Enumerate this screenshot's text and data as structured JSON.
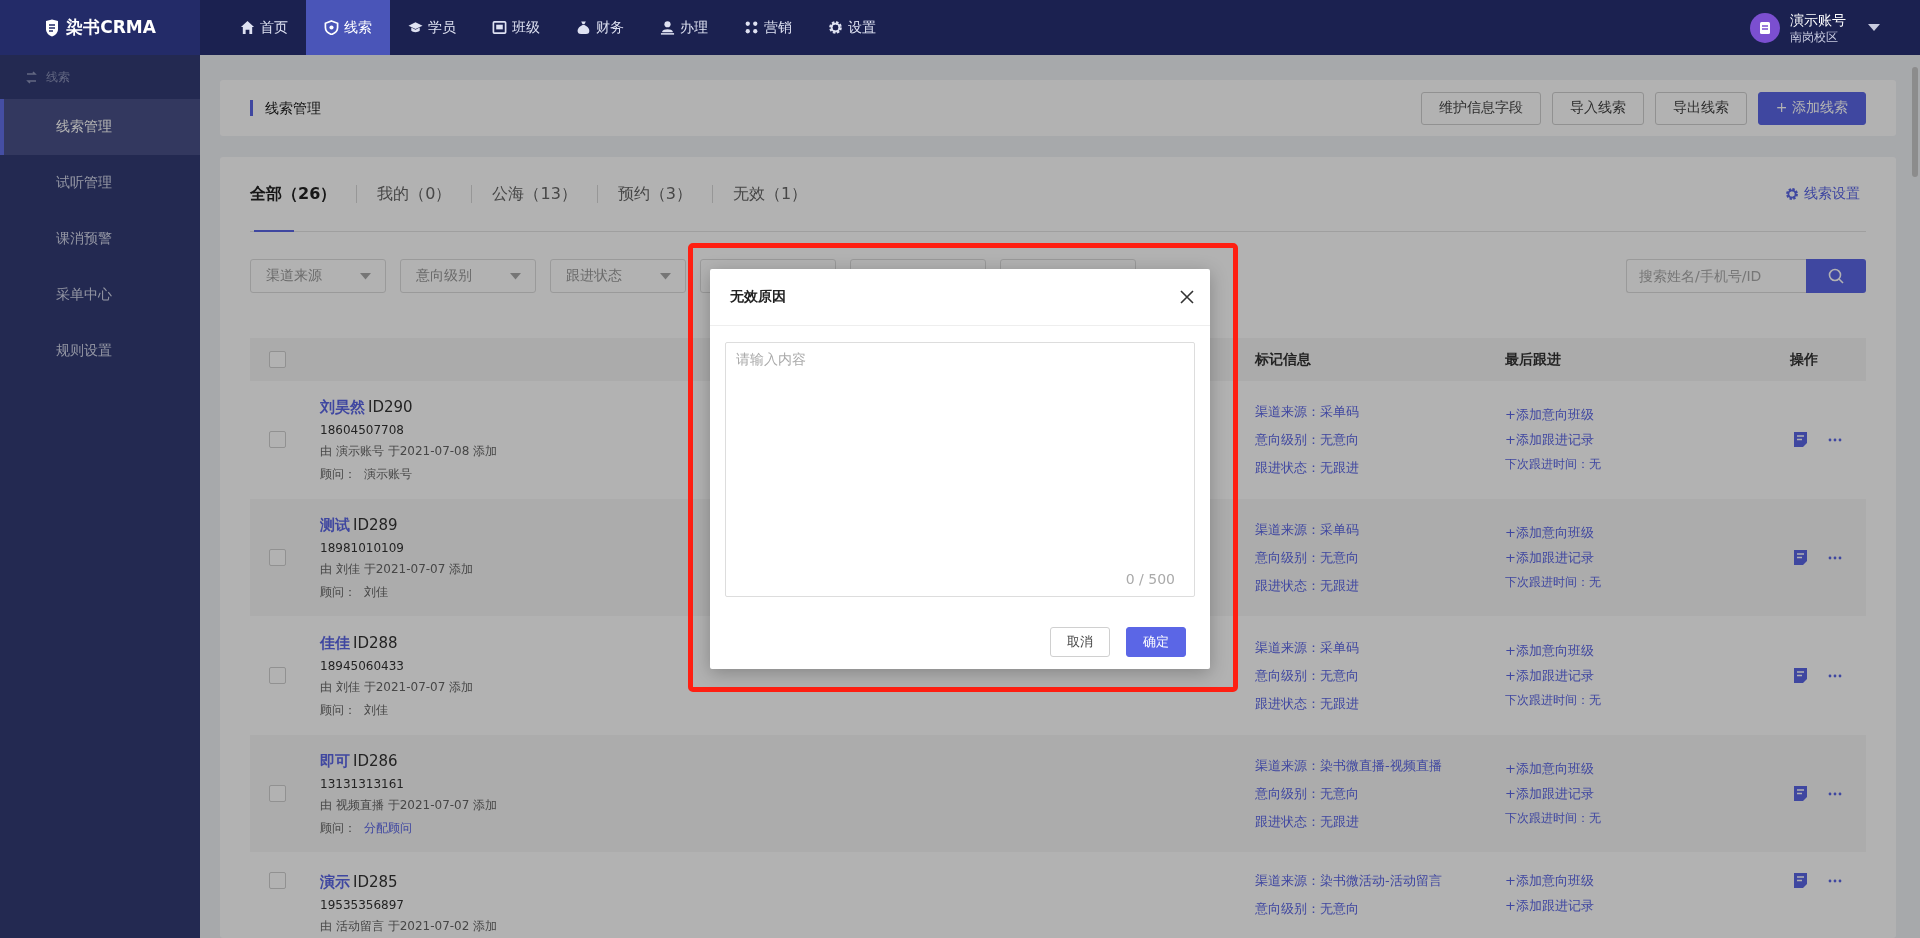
{
  "top_nav": {
    "logo": "染书CRMA",
    "items": [
      {
        "label": "首页",
        "selected": false
      },
      {
        "label": "线索",
        "selected": true
      },
      {
        "label": "学员",
        "selected": false
      },
      {
        "label": "班级",
        "selected": false
      },
      {
        "label": "财务",
        "selected": false
      },
      {
        "label": "办理",
        "selected": false
      },
      {
        "label": "营销",
        "selected": false
      },
      {
        "label": "设置",
        "selected": false
      }
    ],
    "user": {
      "name": "演示账号",
      "campus": "南岗校区"
    }
  },
  "sidebar": {
    "section": "线索",
    "items": [
      {
        "label": "线索管理",
        "selected": true
      },
      {
        "label": "试听管理",
        "selected": false
      },
      {
        "label": "课消预警",
        "selected": false
      },
      {
        "label": "采单中心",
        "selected": false
      },
      {
        "label": "规则设置",
        "selected": false
      }
    ]
  },
  "page_header": {
    "title": "线索管理",
    "buttons": [
      {
        "label": "维护信息字段",
        "kind": "default"
      },
      {
        "label": "导入线索",
        "kind": "default"
      },
      {
        "label": "导出线索",
        "kind": "default"
      },
      {
        "label": "+ 添加线索",
        "kind": "primary"
      }
    ]
  },
  "tabs": [
    {
      "label": "全部（26）",
      "selected": true
    },
    {
      "label": "我的（0）",
      "selected": false
    },
    {
      "label": "公海（13）",
      "selected": false
    },
    {
      "label": "预约（3）",
      "selected": false
    },
    {
      "label": "无效（1）",
      "selected": false
    }
  ],
  "settings_link": "线索设置",
  "filters": [
    {
      "kind": "labeled",
      "label": "渠道来源"
    },
    {
      "kind": "labeled",
      "label": "意向级别"
    },
    {
      "kind": "labeled",
      "label": "跟进状态"
    },
    {
      "kind": "covered"
    },
    {
      "kind": "covered"
    },
    {
      "kind": "covered"
    }
  ],
  "search": {
    "placeholder": "搜索姓名/手机号/ID"
  },
  "table": {
    "select_all_checked": false,
    "columns": [
      "标记信息",
      "最后跟进",
      "操作"
    ],
    "rows": [
      {
        "checked": false,
        "name": "刘昊然",
        "id": "ID290",
        "phone": "18604507708",
        "added": "由 演示账号 于2021-07-08 添加",
        "advisor_label": "顾问：",
        "advisor": "演示账号",
        "assigned": true,
        "tags": [
          "渠道来源：采单码",
          "意向级别：无意向",
          "跟进状态：无跟进"
        ],
        "follow": [
          "+添加意向班级",
          "+添加跟进记录",
          "下次跟进时间：无"
        ]
      },
      {
        "checked": false,
        "name": "测试",
        "id": "ID289",
        "phone": "18981010109",
        "added": "由 刘佳 于2021-07-07 添加",
        "advisor_label": "顾问：",
        "advisor": "刘佳",
        "assigned": true,
        "tags": [
          "渠道来源：采单码",
          "意向级别：无意向",
          "跟进状态：无跟进"
        ],
        "follow": [
          "+添加意向班级",
          "+添加跟进记录",
          "下次跟进时间：无"
        ]
      },
      {
        "checked": false,
        "name": "佳佳",
        "id": "ID288",
        "phone": "18945060433",
        "added": "由 刘佳 于2021-07-07 添加",
        "advisor_label": "顾问：",
        "advisor": "刘佳",
        "assigned": true,
        "tags": [
          "渠道来源：采单码",
          "意向级别：无意向",
          "跟进状态：无跟进"
        ],
        "follow": [
          "+添加意向班级",
          "+添加跟进记录",
          "下次跟进时间：无"
        ]
      },
      {
        "checked": false,
        "name": "即可",
        "id": "ID286",
        "phone": "13131313161",
        "added": "由 视频直播 于2021-07-07 添加",
        "advisor_label": "顾问：",
        "advisor": "分配顾问",
        "assigned": false,
        "tags": [
          "渠道来源：染书微直播-视频直播",
          "意向级别：无意向",
          "跟进状态：无跟进"
        ],
        "follow": [
          "+添加意向班级",
          "+添加跟进记录",
          "下次跟进时间：无"
        ]
      },
      {
        "checked": false,
        "name": "演示",
        "id": "ID285",
        "phone": "19535356897",
        "added": "由 活动留言 于2021-07-02 添加",
        "tags": [
          "渠道来源：染书微活动-活动留言",
          "意向级别：无意向"
        ],
        "follow": [
          "+添加意向班级",
          "+添加跟进记录"
        ]
      }
    ]
  },
  "modal": {
    "title": "无效原因",
    "placeholder": "请输入内容",
    "counter": "0 / 500",
    "buttons": [
      {
        "label": "取消",
        "kind": "default"
      },
      {
        "label": "确定",
        "kind": "primary"
      }
    ]
  }
}
